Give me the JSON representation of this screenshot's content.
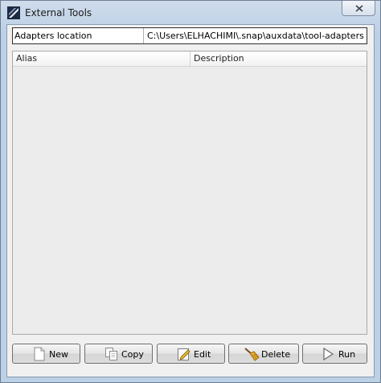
{
  "window": {
    "title": "External Tools"
  },
  "adapters": {
    "label": "Adapters location",
    "path": "C:\\Users\\ELHACHIMI\\.snap\\auxdata\\tool-adapters"
  },
  "table": {
    "columns": [
      "Alias",
      "Description"
    ],
    "rows": []
  },
  "buttons": {
    "new": "New",
    "copy": "Copy",
    "edit": "Edit",
    "delete": "Delete",
    "run": "Run"
  }
}
